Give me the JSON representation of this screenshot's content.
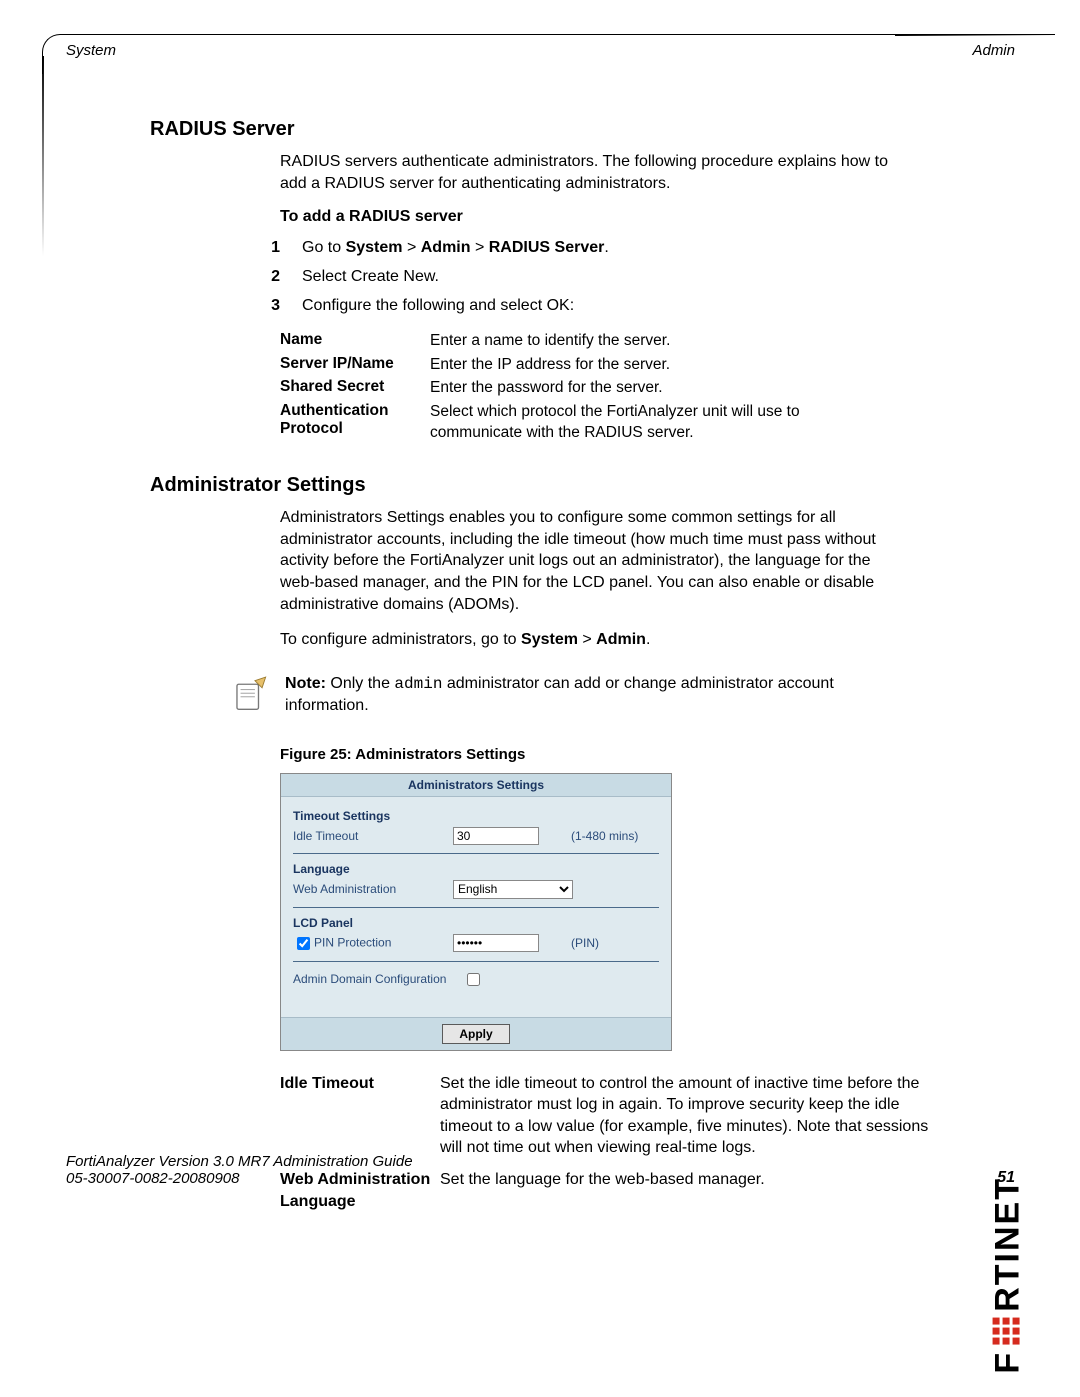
{
  "header": {
    "left": "System",
    "right": "Admin"
  },
  "radius": {
    "heading": "RADIUS Server",
    "intro": "RADIUS servers authenticate administrators. The following procedure explains how to add a RADIUS server for authenticating administrators.",
    "subheading": "To add a RADIUS server",
    "steps": [
      {
        "n": "1",
        "pre": "Go to ",
        "path": [
          "System",
          "Admin",
          "RADIUS Server"
        ],
        "post": "."
      },
      {
        "n": "2",
        "text": "Select Create New."
      },
      {
        "n": "3",
        "text": "Configure the following and select OK:"
      }
    ],
    "defs": [
      {
        "label": "Name",
        "desc": "Enter a name to identify the server."
      },
      {
        "label": "Server IP/Name",
        "desc": "Enter the IP address for the server."
      },
      {
        "label": "Shared Secret",
        "desc": "Enter the password for the server."
      },
      {
        "label": "Authentication Protocol",
        "desc": "Select which protocol the FortiAnalyzer unit will use to communicate with the RADIUS server."
      }
    ]
  },
  "admin_settings": {
    "heading": "Administrator Settings",
    "para1": "Administrators Settings enables you to configure some common settings for all administrator accounts, including the idle timeout (how much time must pass without activity before the FortiAnalyzer unit logs out an administrator), the language for the web-based manager, and the PIN for the LCD panel. You can also enable or disable administrative domains (ADOMs).",
    "para2_pre": "To configure administrators, go to ",
    "para2_bold1": "System",
    "para2_sep": " > ",
    "para2_bold2": "Admin",
    "para2_post": ".",
    "note_prefix": "Note:",
    "note_text_pre": " Only the ",
    "note_code": "admin",
    "note_text_post": " administrator can add or change administrator account information.",
    "figure_caption": "Figure 25: Administrators Settings",
    "screenshot": {
      "title": "Administrators Settings",
      "timeout_section": "Timeout Settings",
      "idle_label": "Idle Timeout",
      "idle_value": "30",
      "idle_hint": "(1-480 mins)",
      "language_section": "Language",
      "webadmin_label": "Web Administration",
      "webadmin_value": "English",
      "lcd_section": "LCD Panel",
      "pin_label": "PIN Protection",
      "pin_checked": true,
      "pin_value": "******",
      "pin_hint": "(PIN)",
      "adom_label": "Admin Domain Configuration",
      "adom_checked": false,
      "apply": "Apply"
    },
    "post_defs": [
      {
        "label": "Idle Timeout",
        "desc": "Set the idle timeout to control the amount of inactive time before the administrator must log in again. To improve security keep the idle timeout to a low value (for example, five minutes).\nNote that sessions will not time out when viewing real-time logs."
      },
      {
        "label": "Web Administration Language",
        "desc": "Set the language for the web-based manager."
      }
    ]
  },
  "footer": {
    "title": "FortiAnalyzer Version 3.0 MR7 Administration Guide",
    "code": "05-30007-0082-20080908",
    "page": "51"
  },
  "brand": {
    "pre": "F",
    "post": "RTINET"
  }
}
